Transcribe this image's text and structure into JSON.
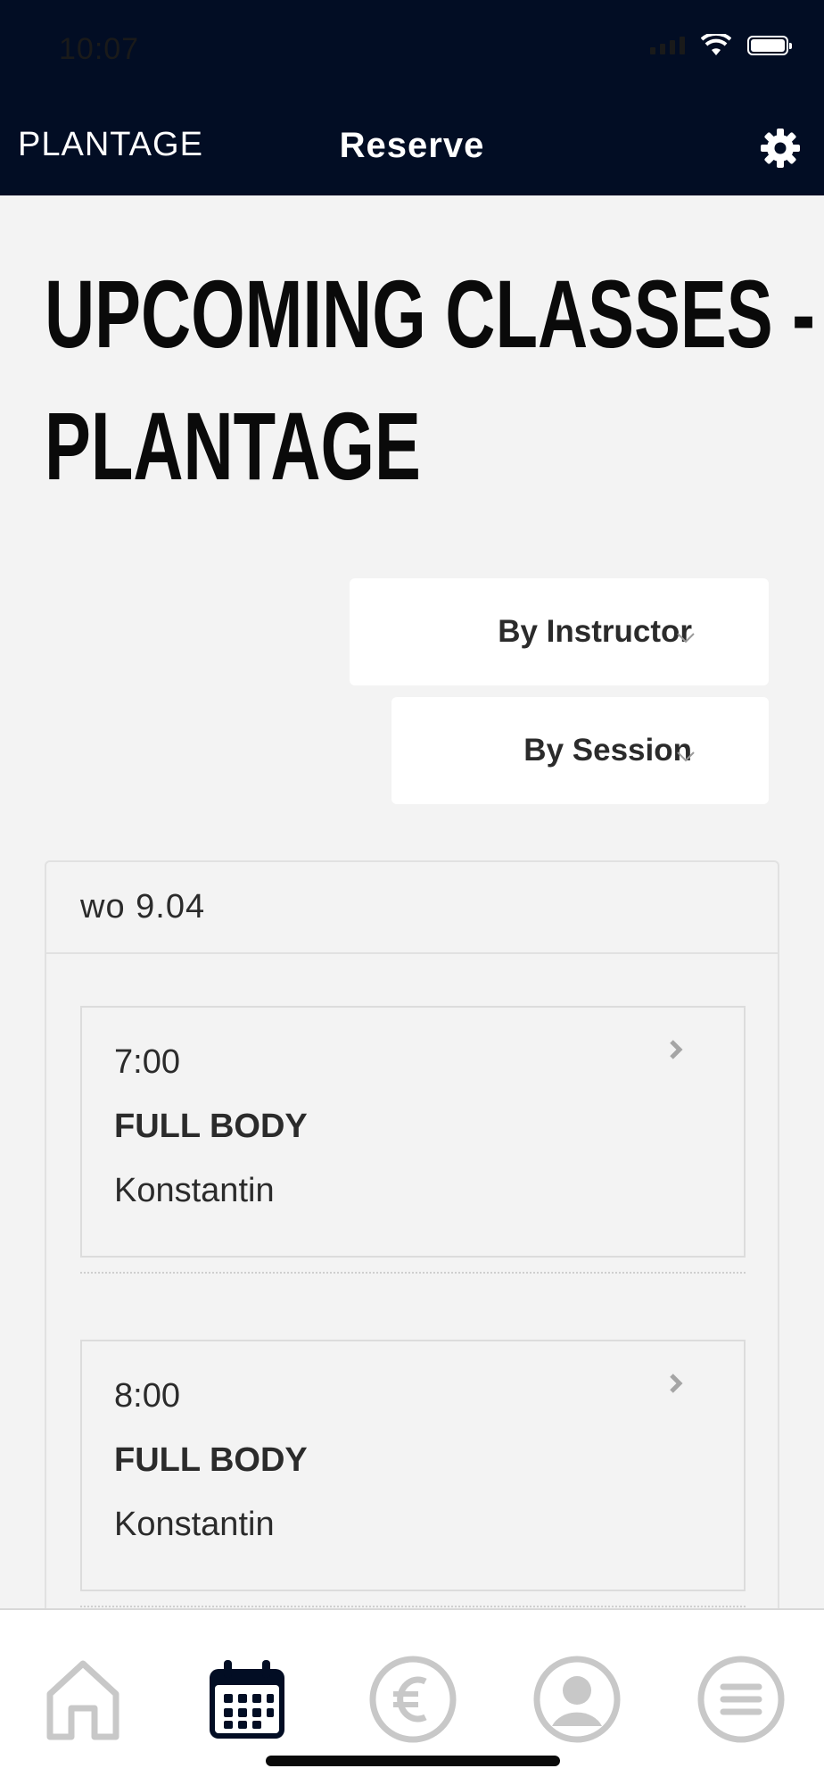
{
  "status_bar": {
    "time": "10:07"
  },
  "nav": {
    "studio": "PLANTAGE",
    "title": "Reserve"
  },
  "page": {
    "title_line1": "UPCOMING CLASSES -",
    "title_line2": "PLANTAGE"
  },
  "filters": {
    "instructor_label": "By Instructor",
    "session_label": "By Session"
  },
  "schedule": {
    "day_label": "wo 9.04",
    "sessions": [
      {
        "time": "7:00",
        "name": "FULL BODY",
        "instructor": "Konstantin"
      },
      {
        "time": "8:00",
        "name": "FULL BODY",
        "instructor": "Konstantin"
      }
    ]
  },
  "tabbar": {
    "items": [
      "home-icon",
      "calendar-icon",
      "euro-icon",
      "profile-icon",
      "menu-icon"
    ],
    "active": "calendar-icon"
  },
  "colors": {
    "header_bg": "#020d24",
    "page_bg": "#f3f3f3",
    "active_tab": "#020d24",
    "inactive_tab": "#c8c8c8"
  }
}
